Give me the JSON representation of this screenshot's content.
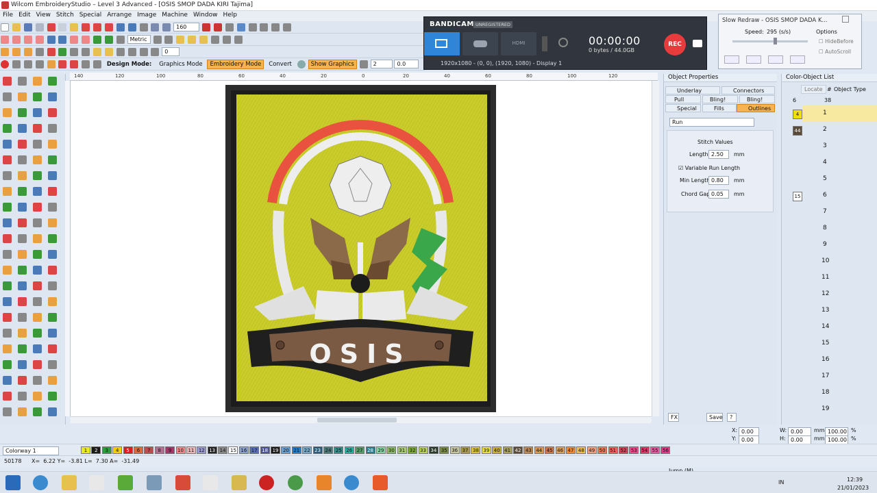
{
  "window": {
    "title": "Wilcom EmbroideryStudio – Level 3 Advanced - [OSIS SMOP DADA KIRI      Tajima]"
  },
  "menu": [
    "File",
    "Edit",
    "View",
    "Stitch",
    "Special",
    "Arrange",
    "Image",
    "Machine",
    "Window",
    "Help"
  ],
  "toolbar": {
    "zoom_value": "160",
    "units": "Metric",
    "design_mode_label": "Design Mode:",
    "graphics_mode": "Graphics Mode",
    "embroidery_mode": "Embroidery Mode",
    "convert": "Convert",
    "show_graphics": "Show Graphics",
    "spin1": "2",
    "spin2": "0.0",
    "spin3": "0"
  },
  "ruler": {
    "h_ticks": [
      "140",
      "120",
      "100",
      "80",
      "60",
      "40",
      "20",
      "0",
      "20",
      "40",
      "60",
      "80",
      "100",
      "120"
    ]
  },
  "artwork": {
    "badge_text": "OSIS"
  },
  "bandicam": {
    "brand": "BANDICAM",
    "unregistered": "UNREGISTERED",
    "hdmi_label": "HDMI",
    "timer": "00:00:00",
    "size": "0 bytes / 44.0GB",
    "rec": "REC",
    "resolution": "1920x1080 - (0, 0), (1920, 1080) - Display 1"
  },
  "slow_redraw": {
    "title": "Slow Redraw - OSIS SMOP DADA K...",
    "speed_label": "Speed:",
    "speed_value": "295 (s/s)",
    "options_label": "Options",
    "hide_before": "HideBefore",
    "auto_scroll": "AutoScroll"
  },
  "object_properties": {
    "title": "Object Properties",
    "tabs": [
      "Underlay",
      "Connectors",
      "Pull Comp",
      "Bling! Run",
      "Bling! Fills",
      "Special",
      "Fills",
      "Outlines"
    ],
    "outline_type": "Run",
    "section_title": "Stitch Values",
    "length_label": "Length",
    "length_value": "2.50",
    "unit": "mm",
    "variable_run": "Variable Run Length",
    "min_length_label": "Min Length",
    "min_length_value": "0.80",
    "chord_gap_label": "Chord Gap",
    "chord_gap_value": "0.05",
    "fx": "FX",
    "save": "Save",
    "help": "?"
  },
  "color_object_list": {
    "title": "Color-Object List",
    "locate": "Locate",
    "hash": "#",
    "object_type": "Object Type",
    "col_a": "6",
    "col_b": "38",
    "groups": [
      "4",
      "44",
      "15"
    ],
    "rows": [
      "1",
      "2",
      "3",
      "4",
      "5",
      "6",
      "7",
      "8",
      "9",
      "10",
      "11",
      "12",
      "13",
      "14",
      "15",
      "16",
      "17",
      "18",
      "19"
    ]
  },
  "coords": {
    "x_label": "X:",
    "x_value": "0.00",
    "y_label": "Y:",
    "y_value": "0.00",
    "w_label": "W:",
    "w_value": "0.00",
    "h_label": "H:",
    "h_value": "0.00",
    "unit": "mm",
    "sx_value": "100.00",
    "sy_value": "100.00",
    "pct": "%"
  },
  "colorway": {
    "label": "Colorway 1",
    "swatches": [
      "1",
      "2",
      "3",
      "4",
      "5",
      "6",
      "7",
      "8",
      "9",
      "10",
      "11",
      "12",
      "13",
      "14",
      "15",
      "16",
      "17",
      "18",
      "19",
      "20",
      "21",
      "22",
      "23",
      "24",
      "25",
      "26",
      "27",
      "28",
      "29",
      "30",
      "31",
      "32",
      "33",
      "34",
      "35",
      "36",
      "37",
      "38",
      "39",
      "40",
      "41",
      "42",
      "43",
      "44",
      "45",
      "46",
      "47",
      "48",
      "49",
      "50",
      "51",
      "52",
      "53",
      "54",
      "55",
      "56"
    ],
    "colors": [
      "#e8e82a",
      "#1a1a1a",
      "#2e9a3e",
      "#f0d000",
      "#d42020",
      "#d96a3c",
      "#b84e4e",
      "#b07090",
      "#9c3a6a",
      "#e88a8a",
      "#e8b8b8",
      "#9999cc",
      "#222222",
      "#888888",
      "#ffffff",
      "#8aa0c8",
      "#5a6fb0",
      "#4a5590",
      "#1a1a1a",
      "#6aa0d0",
      "#2a7ac0",
      "#78a8c8",
      "#2a5a7a",
      "#4a7a7a",
      "#3a8a8a",
      "#2ab0a0",
      "#5a9a6a",
      "#2a7a8a",
      "#8ad0a0",
      "#8ab86a",
      "#a8c87a",
      "#7aa83a",
      "#b8d060",
      "#2a3a2a",
      "#7a8a4a",
      "#c8c8a0",
      "#a89850",
      "#d8c040",
      "#e8e040",
      "#c8b030",
      "#a8a060",
      "#5a4a3a",
      "#b8885a",
      "#d89850",
      "#c8784a",
      "#d8a060",
      "#e88a3a",
      "#e8c050",
      "#f0a080",
      "#e87a5a",
      "#e8605a",
      "#c8485a",
      "#e84a8a",
      "#d83a6a",
      "#e05aa0",
      "#e03a8a"
    ]
  },
  "status": {
    "stitch_count": "50178",
    "position": "X=  6.22 Y=  -3.81 L=  7.30 A=  -31.49",
    "jump": "Jump (M)"
  },
  "tray": {
    "lang": "IN",
    "time": "12:39",
    "date": "21/01/2023"
  }
}
